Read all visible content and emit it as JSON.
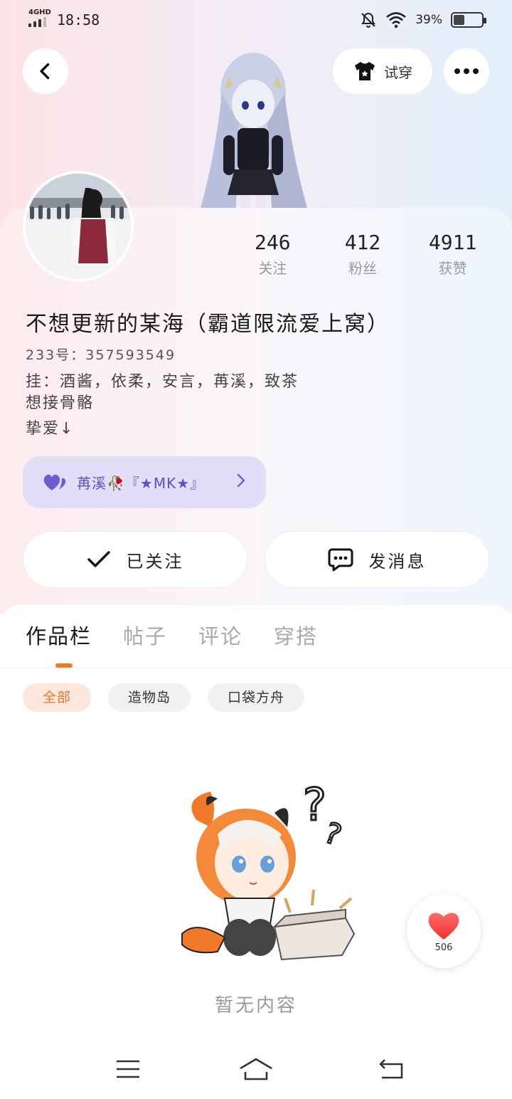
{
  "status_bar": {
    "network": "4GHD",
    "time": "18:58",
    "battery_text": "39%",
    "battery_level": 0.39
  },
  "header": {
    "try_on_label": "试穿"
  },
  "profile": {
    "stats": [
      {
        "value": "246",
        "label": "关注"
      },
      {
        "value": "412",
        "label": "粉丝"
      },
      {
        "value": "4911",
        "label": "获赞"
      }
    ],
    "username": "不想更新的某海（霸道限流爱上窝）",
    "uid": "233号：357593549",
    "bio_lines": [
      "挂：酒酱，依柔，安言，苒溪，致茶",
      "想接骨骼",
      "挚爱↓"
    ],
    "cp_tag": {
      "label": "苒溪🥀『★MK★』"
    },
    "follow_label": "已关注",
    "message_label": "发消息"
  },
  "tabs": [
    {
      "label": "作品栏",
      "active": true
    },
    {
      "label": "帖子",
      "active": false
    },
    {
      "label": "评论",
      "active": false
    },
    {
      "label": "穿搭",
      "active": false
    }
  ],
  "chips": [
    {
      "label": "全部",
      "active": true
    },
    {
      "label": "造物岛",
      "active": false
    },
    {
      "label": "口袋方舟",
      "active": false
    }
  ],
  "empty_text": "暂无内容",
  "like_float": {
    "count": "506"
  },
  "colors": {
    "accent": "#f07a2a",
    "cp_bg": "#e2def7",
    "cp_text": "#5a51c7"
  }
}
